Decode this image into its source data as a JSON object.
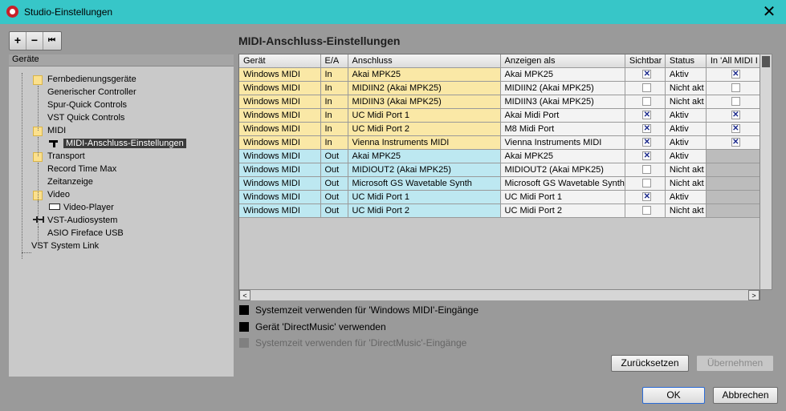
{
  "window": {
    "title": "Studio-Einstellungen",
    "close_glyph": "✕"
  },
  "left": {
    "toolbar": {
      "add": "+",
      "remove": "−",
      "reset": "⏮"
    },
    "header": "Geräte",
    "tree": [
      {
        "label": "Fernbedienungsgeräte",
        "icon": "folder-icon",
        "level": 1
      },
      {
        "label": "Generischer Controller",
        "level": 2
      },
      {
        "label": "Spur-Quick Controls",
        "level": 2
      },
      {
        "label": "VST Quick Controls",
        "level": 2
      },
      {
        "label": "MIDI",
        "icon": "folder-icon",
        "level": 1
      },
      {
        "label": "MIDI-Anschluss-Einstellungen",
        "icon": "midi-port-icon",
        "level": 2,
        "selected": true
      },
      {
        "label": "Transport",
        "icon": "folder-icon",
        "level": 1
      },
      {
        "label": "Record Time Max",
        "level": 2
      },
      {
        "label": "Zeitanzeige",
        "level": 2
      },
      {
        "label": "Video",
        "icon": "folder-icon",
        "level": 1
      },
      {
        "label": "Video-Player",
        "icon": "video-player-icon",
        "level": 2
      },
      {
        "label": "VST-Audiosystem",
        "icon": "audio-icon",
        "level": 1
      },
      {
        "label": "ASIO Fireface USB",
        "level": 2
      },
      {
        "label": "VST System Link",
        "level": 0
      }
    ]
  },
  "panel": {
    "title": "MIDI-Anschluss-Einstellungen",
    "columns": [
      "Gerät",
      "E/A",
      "Anschluss",
      "Anzeigen als",
      "Sichtbar",
      "Status",
      "In 'All MIDI I"
    ],
    "rows": [
      {
        "dev": "Windows MIDI",
        "io": "In",
        "port": "Akai MPK25",
        "show": "Akai MPK25",
        "visible": true,
        "status": "Aktiv",
        "allmidi": true
      },
      {
        "dev": "Windows MIDI",
        "io": "In",
        "port": "MIDIIN2 (Akai MPK25)",
        "show": "MIDIIN2 (Akai MPK25)",
        "visible": false,
        "status": "Nicht akt",
        "allmidi": false
      },
      {
        "dev": "Windows MIDI",
        "io": "In",
        "port": "MIDIIN3 (Akai MPK25)",
        "show": "MIDIIN3 (Akai MPK25)",
        "visible": false,
        "status": "Nicht akt",
        "allmidi": false
      },
      {
        "dev": "Windows MIDI",
        "io": "In",
        "port": "UC Midi Port 1",
        "show": "Akai Midi Port",
        "visible": true,
        "status": "Aktiv",
        "allmidi": true
      },
      {
        "dev": "Windows MIDI",
        "io": "In",
        "port": "UC Midi Port 2",
        "show": "M8 Midi Port",
        "visible": true,
        "status": "Aktiv",
        "allmidi": true
      },
      {
        "dev": "Windows MIDI",
        "io": "In",
        "port": "Vienna Instruments MIDI",
        "show": "Vienna Instruments MIDI",
        "visible": true,
        "status": "Aktiv",
        "allmidi": true
      },
      {
        "dev": "Windows MIDI",
        "io": "Out",
        "port": "Akai MPK25",
        "show": "Akai MPK25",
        "visible": true,
        "status": "Aktiv",
        "allmidi": null
      },
      {
        "dev": "Windows MIDI",
        "io": "Out",
        "port": "MIDIOUT2 (Akai MPK25)",
        "show": "MIDIOUT2 (Akai MPK25)",
        "visible": false,
        "status": "Nicht akt",
        "allmidi": null
      },
      {
        "dev": "Windows MIDI",
        "io": "Out",
        "port": "Microsoft GS Wavetable Synth",
        "show": "Microsoft GS Wavetable Synth",
        "visible": false,
        "status": "Nicht akt",
        "allmidi": null
      },
      {
        "dev": "Windows MIDI",
        "io": "Out",
        "port": "UC Midi Port 1",
        "show": "UC Midi Port 1",
        "visible": true,
        "status": "Aktiv",
        "allmidi": null
      },
      {
        "dev": "Windows MIDI",
        "io": "Out",
        "port": "UC Midi Port 2",
        "show": "UC Midi Port 2",
        "visible": false,
        "status": "Nicht akt",
        "allmidi": null
      }
    ],
    "options": [
      {
        "label": "Systemzeit verwenden für 'Windows MIDI'-Eingänge",
        "enabled": true
      },
      {
        "label": "Gerät 'DirectMusic' verwenden",
        "enabled": true
      },
      {
        "label": "Systemzeit verwenden für 'DirectMusic'-Eingänge",
        "enabled": false
      }
    ],
    "reset_label": "Zurücksetzen",
    "apply_label": "Übernehmen"
  },
  "footer": {
    "ok_label": "OK",
    "cancel_label": "Abbrechen"
  },
  "colors": {
    "titlebar": "#37c6c8",
    "row_in": "#fae8a6",
    "row_out": "#bde8f1",
    "checkbox_mark": "#1c2a8c"
  }
}
